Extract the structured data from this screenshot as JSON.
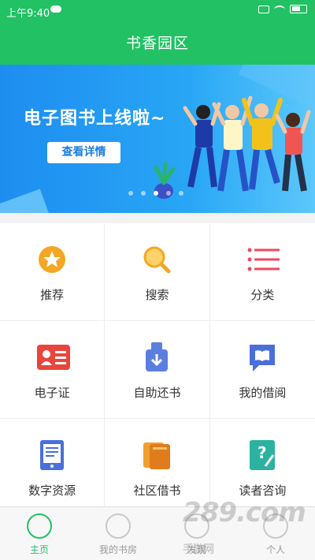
{
  "status_bar": {
    "time": "上午9:40"
  },
  "header": {
    "title": "书香园区",
    "color": "#21c164"
  },
  "banner": {
    "headline": "电子图书上线啦~",
    "button_label": "查看详情",
    "slide_count": 5,
    "active_slide": 3
  },
  "grid": {
    "items": [
      {
        "label": "推荐",
        "icon": "star-icon"
      },
      {
        "label": "搜索",
        "icon": "search-icon"
      },
      {
        "label": "分类",
        "icon": "list-icon"
      },
      {
        "label": "电子证",
        "icon": "id-card-icon"
      },
      {
        "label": "自助还书",
        "icon": "return-book-icon"
      },
      {
        "label": "我的借阅",
        "icon": "book-chat-icon"
      },
      {
        "label": "数字资源",
        "icon": "tablet-doc-icon"
      },
      {
        "label": "社区借书",
        "icon": "books-icon"
      },
      {
        "label": "读者咨询",
        "icon": "question-edit-icon"
      }
    ]
  },
  "bottom_nav": {
    "items": [
      {
        "label": "主页",
        "icon": "home-icon",
        "active": true
      },
      {
        "label": "我的书房",
        "icon": "bookshelf-icon",
        "active": false
      },
      {
        "label": "发现",
        "icon": "discover-icon",
        "active": false
      },
      {
        "label": "个人",
        "icon": "user-icon",
        "active": false
      }
    ]
  },
  "watermark": {
    "text": "289.com",
    "sub": "手游网"
  }
}
